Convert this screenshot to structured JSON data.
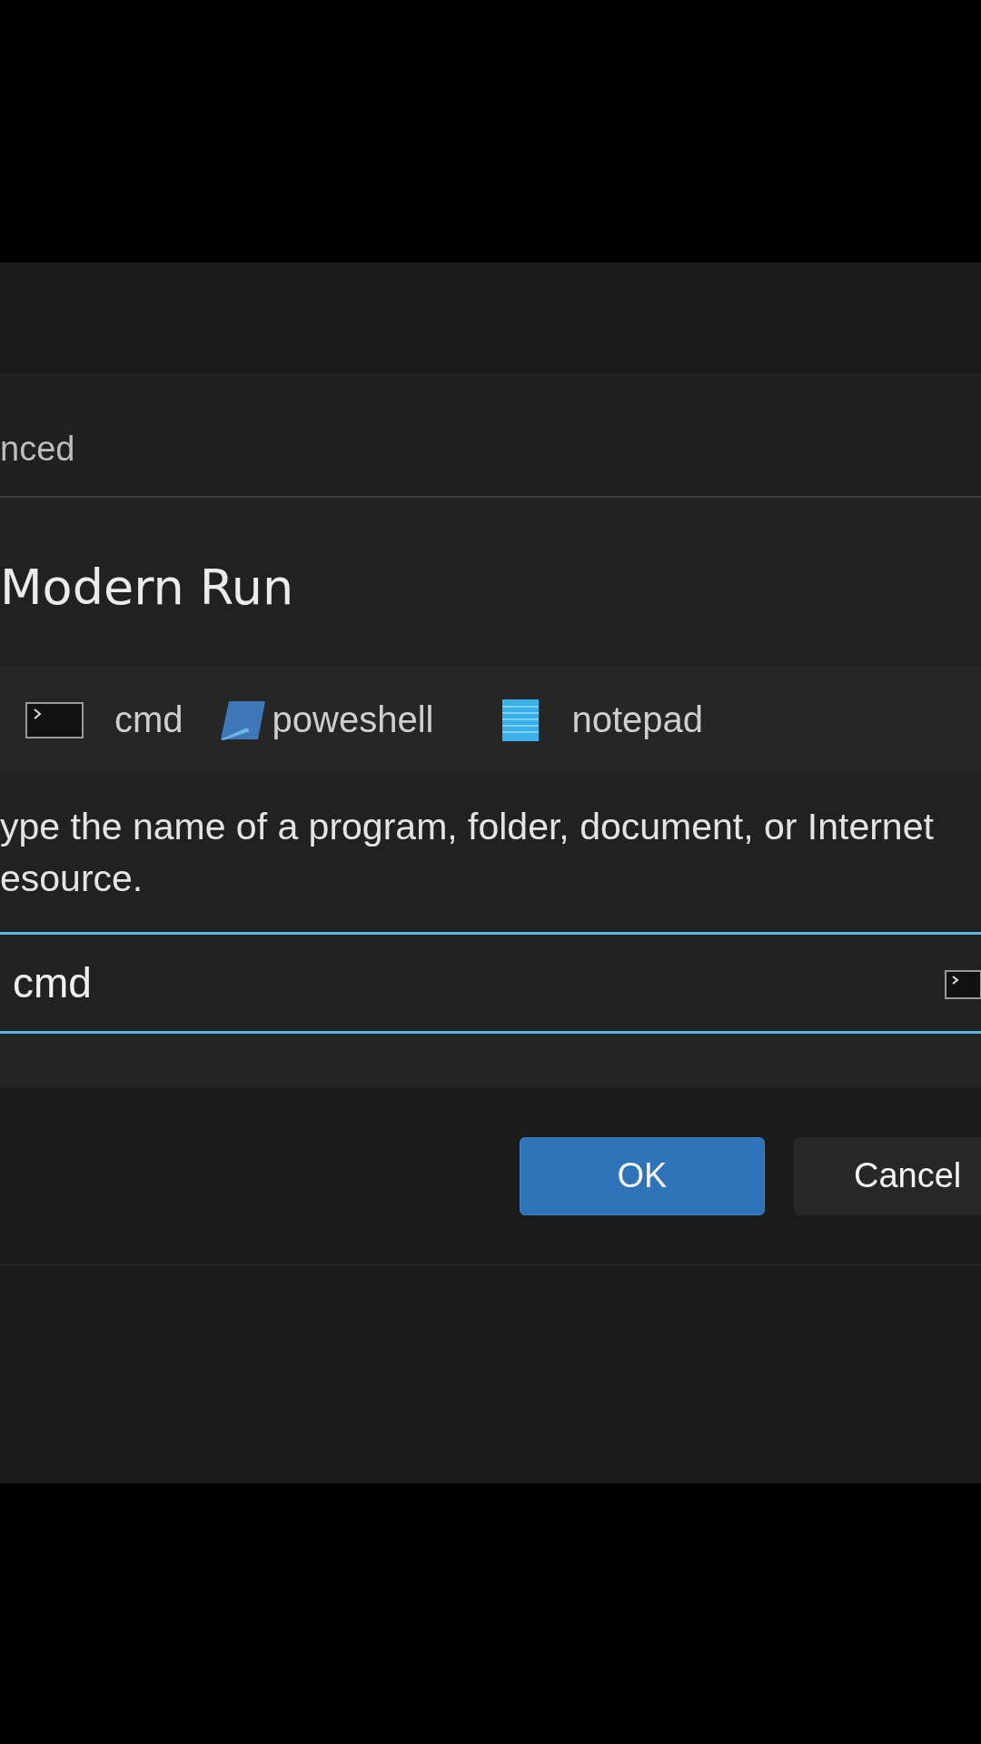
{
  "nav_item": {
    "label": "nced"
  },
  "title": "Modern Run",
  "quick_launch": [
    {
      "label": "cmd",
      "kind": "terminal"
    },
    {
      "label": "poweshell",
      "kind": "shell"
    },
    {
      "label": "notepad",
      "kind": "notepad"
    }
  ],
  "description": {
    "lines": [
      "ype the name of a program, folder, document, or Internet",
      "esource."
    ]
  },
  "run_field": {
    "value": "cmd",
    "focused": true
  },
  "buttons": [
    {
      "label": "OK",
      "kind": "primary"
    },
    {
      "label": "Cancel",
      "kind": "secondary"
    }
  ]
}
